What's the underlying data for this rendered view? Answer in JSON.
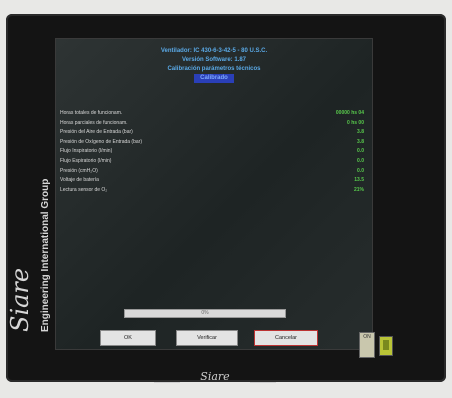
{
  "header": {
    "line1": "Ventilador: IC 430-6-3-42-5 - 80 U.S.C.",
    "line2": "Versión Software: 1.87",
    "line3": "Calibración parámetros técnicos",
    "line4": "Calibrado"
  },
  "rows": [
    {
      "label": "Horas totales de funcionam.",
      "value": "00000 hs 04"
    },
    {
      "label": "Horas parciales de funcionam.",
      "value": "0 hs 00"
    },
    {
      "label": "Presión del Aire de Entrada (bar)",
      "value": "3.8"
    },
    {
      "label": "Presión de Oxígeno de Entrada (bar)",
      "value": "3.8"
    },
    {
      "label": "Flujo Inspiratorio (l/min)",
      "value": "0.0"
    },
    {
      "label": "Flujo Espiratorio (l/min)",
      "value": "0.0"
    },
    {
      "label": "Presión (cmH₂O)",
      "value": "0.0"
    },
    {
      "label": "Voltaje de batería",
      "value": "13.5"
    },
    {
      "label": "Lectura sensor de O₂",
      "value": "21%"
    }
  ],
  "progress": {
    "label": "0%",
    "fraction": 0.0
  },
  "buttons": {
    "ok": "OK",
    "verify": "Verificar",
    "cancel": "Cancelar"
  },
  "brand": {
    "name": "Siare",
    "tagline": "Engineering International Group"
  },
  "side": {
    "power_label": "ON"
  }
}
